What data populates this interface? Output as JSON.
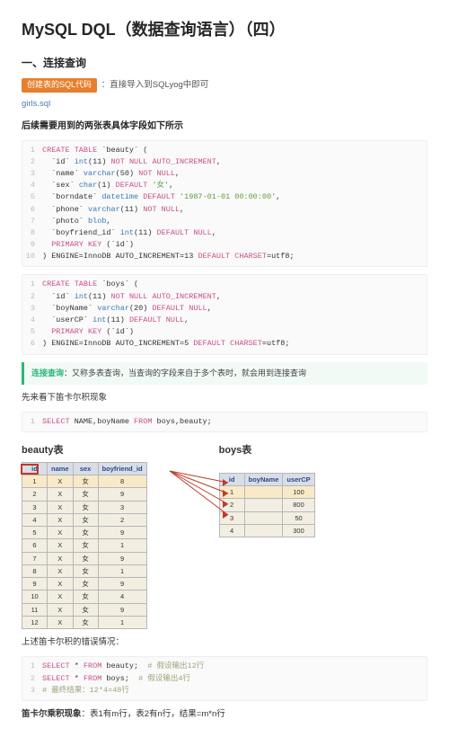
{
  "title": "MySQL DQL（数据查询语言）（四）",
  "section1": {
    "heading": "一、连接查询",
    "tag": "创建表的SQL代码",
    "tag_desc": "：直接导入到SQLyog中即可",
    "link": "girls.sql",
    "intro": "后续需要用到的两张表具体字段如下所示"
  },
  "code1": [
    [
      [
        "kw",
        "CREATE TABLE"
      ],
      [
        "",
        " `beauty` ("
      ]
    ],
    [
      [
        "",
        "  `id` "
      ],
      [
        "kw2",
        "int"
      ],
      [
        "",
        "(11) "
      ],
      [
        "kw",
        "NOT NULL AUTO_INCREMENT"
      ],
      [
        "",
        ","
      ]
    ],
    [
      [
        "",
        "  `name` "
      ],
      [
        "kw2",
        "varchar"
      ],
      [
        "",
        "(50) "
      ],
      [
        "kw",
        "NOT NULL"
      ],
      [
        "",
        ","
      ]
    ],
    [
      [
        "",
        "  `sex` "
      ],
      [
        "kw2",
        "char"
      ],
      [
        "",
        "(1) "
      ],
      [
        "kw",
        "DEFAULT"
      ],
      [
        "",
        " "
      ],
      [
        "str",
        "'女'"
      ],
      [
        "",
        ","
      ]
    ],
    [
      [
        "",
        "  `borndate` "
      ],
      [
        "kw2",
        "datetime"
      ],
      [
        "",
        " "
      ],
      [
        "kw",
        "DEFAULT"
      ],
      [
        "",
        " "
      ],
      [
        "str",
        "'1987-01-01 00:00:00'"
      ],
      [
        "",
        ","
      ]
    ],
    [
      [
        "",
        "  `phone` "
      ],
      [
        "kw2",
        "varchar"
      ],
      [
        "",
        "(11) "
      ],
      [
        "kw",
        "NOT NULL"
      ],
      [
        "",
        ","
      ]
    ],
    [
      [
        "",
        "  `photo` "
      ],
      [
        "kw2",
        "blob"
      ],
      [
        "",
        ","
      ]
    ],
    [
      [
        "",
        "  `boyfriend_id` "
      ],
      [
        "kw2",
        "int"
      ],
      [
        "",
        "(11) "
      ],
      [
        "kw",
        "DEFAULT NULL"
      ],
      [
        "",
        ","
      ]
    ],
    [
      [
        "",
        "  "
      ],
      [
        "kw",
        "PRIMARY KEY"
      ],
      [
        "",
        " (`id`)"
      ]
    ],
    [
      [
        "",
        ") ENGINE=InnoDB AUTO_INCREMENT=13 "
      ],
      [
        "kw",
        "DEFAULT"
      ],
      [
        "",
        " "
      ],
      [
        "kw",
        "CHARSET"
      ],
      [
        "",
        "=utf8;"
      ]
    ]
  ],
  "code2": [
    [
      [
        "kw",
        "CREATE TABLE"
      ],
      [
        "",
        " `boys` ("
      ]
    ],
    [
      [
        "",
        "  `id` "
      ],
      [
        "kw2",
        "int"
      ],
      [
        "",
        "(11) "
      ],
      [
        "kw",
        "NOT NULL AUTO_INCREMENT"
      ],
      [
        "",
        ","
      ]
    ],
    [
      [
        "",
        "  `boyName` "
      ],
      [
        "kw2",
        "varchar"
      ],
      [
        "",
        "(20) "
      ],
      [
        "kw",
        "DEFAULT NULL"
      ],
      [
        "",
        ","
      ]
    ],
    [
      [
        "",
        "  `userCP` "
      ],
      [
        "kw2",
        "int"
      ],
      [
        "",
        "(11) "
      ],
      [
        "kw",
        "DEFAULT NULL"
      ],
      [
        "",
        ","
      ]
    ],
    [
      [
        "",
        "  "
      ],
      [
        "kw",
        "PRIMARY KEY"
      ],
      [
        "",
        " (`id`)"
      ]
    ],
    [
      [
        "",
        ") ENGINE=InnoDB AUTO_INCREMENT=5 "
      ],
      [
        "kw",
        "DEFAULT"
      ],
      [
        "",
        " "
      ],
      [
        "kw",
        "CHARSET"
      ],
      [
        "",
        "=utf8;"
      ]
    ]
  ],
  "callout": {
    "key": "连接查询",
    "text": "：又称多表查询，当查询的字段来自于多个表时，就会用到连接查询"
  },
  "para2": "先来看下笛卡尔积现象",
  "code3": [
    [
      [
        "kw",
        "SELECT"
      ],
      [
        "",
        " NAME,boyName "
      ],
      [
        "kw",
        "FROM"
      ],
      [
        "",
        " boys,beauty;"
      ]
    ]
  ],
  "beauty": {
    "title": "beauty表",
    "headers": [
      "id",
      "name",
      "sex",
      "boyfriend_id"
    ],
    "rows": [
      [
        "1",
        "X",
        "女",
        "8"
      ],
      [
        "2",
        "X",
        "女",
        "9"
      ],
      [
        "3",
        "X",
        "女",
        "3"
      ],
      [
        "4",
        "X",
        "女",
        "2"
      ],
      [
        "5",
        "X",
        "女",
        "9"
      ],
      [
        "6",
        "X",
        "女",
        "1"
      ],
      [
        "7",
        "X",
        "女",
        "9"
      ],
      [
        "8",
        "X",
        "女",
        "1"
      ],
      [
        "9",
        "X",
        "女",
        "9"
      ],
      [
        "10",
        "X",
        "女",
        "4"
      ],
      [
        "11",
        "X",
        "女",
        "9"
      ],
      [
        "12",
        "X",
        "女",
        "1"
      ]
    ]
  },
  "boys": {
    "title": "boys表",
    "headers": [
      "id",
      "boyName",
      "userCP"
    ],
    "rows": [
      [
        "1",
        "",
        "100"
      ],
      [
        "2",
        "",
        "800"
      ],
      [
        "3",
        "",
        "50"
      ],
      [
        "4",
        "",
        "300"
      ]
    ]
  },
  "para3": "上述笛卡尔积的错误情况：",
  "code4": [
    [
      [
        "kw",
        "SELECT"
      ],
      [
        "",
        " * "
      ],
      [
        "kw",
        "FROM"
      ],
      [
        "",
        " beauty;  "
      ],
      [
        "cmt",
        "# 假设输出12行"
      ]
    ],
    [
      [
        "kw",
        "SELECT"
      ],
      [
        "",
        " * "
      ],
      [
        "kw",
        "FROM"
      ],
      [
        "",
        " boys;  "
      ],
      [
        "cmt",
        "# 假设输出4行"
      ]
    ],
    [
      [
        "cmt",
        "# 最终结果：12*4=48行"
      ]
    ]
  ],
  "final": {
    "key": "笛卡尔乘积现象",
    "text": "：表1有m行，表2有n行，结果=m*n行"
  }
}
